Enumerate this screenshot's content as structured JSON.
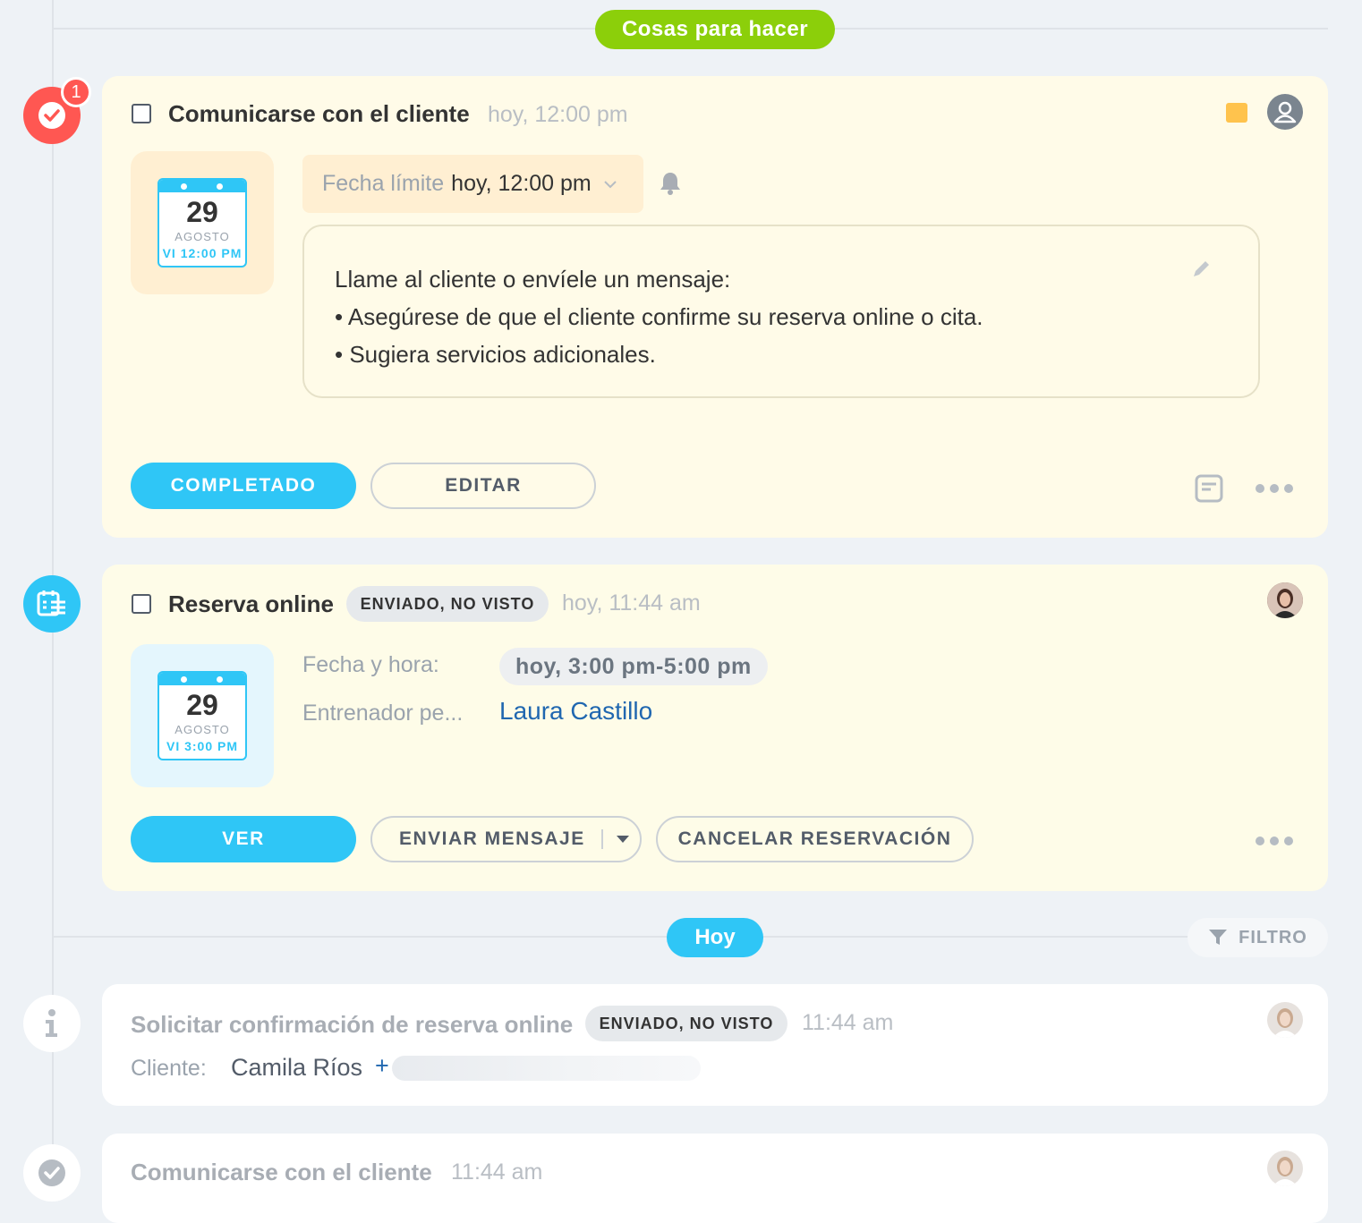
{
  "header_pill": "Cosas para hacer",
  "today_pill": "Hoy",
  "filter_label": "FILTRO",
  "task": {
    "badge_count": "1",
    "title": "Comunicarse con el cliente",
    "time": "hoy, 12:00 pm",
    "deadline_label": "Fecha límite",
    "deadline_value": "hoy, 12:00 pm",
    "calendar": {
      "day": "29",
      "month": "AGOSTO",
      "time": "VI 12:00 PM"
    },
    "description": {
      "line1": "Llame al cliente o envíele un mensaje:",
      "line2": "• Asegúrese de que el cliente confirme su reserva online o cita.",
      "line3": "• Sugiera servicios adicionales."
    },
    "complete_label": "COMPLETADO",
    "edit_label": "EDITAR",
    "color_tag": "#ffc34d"
  },
  "booking": {
    "title": "Reserva online",
    "status": "ENVIADO, NO VISTO",
    "time": "hoy, 11:44 am",
    "calendar": {
      "day": "29",
      "month": "AGOSTO",
      "time": "VI 3:00 PM"
    },
    "date_label": "Fecha y hora:",
    "date_value": "hoy, 3:00 pm-5:00 pm",
    "trainer_label": "Entrenador pe...",
    "trainer_value": "Laura Castillo",
    "view_label": "VER",
    "message_label": "ENVIAR MENSAJE",
    "cancel_label": "CANCELAR RESERVACIÓN"
  },
  "history": [
    {
      "title": "Solicitar confirmación de reserva online",
      "status": "ENVIADO, NO VISTO",
      "time": "11:44 am",
      "client_label": "Cliente:",
      "client_name": "Camila Ríos",
      "client_plus": "+"
    },
    {
      "title": "Comunicarse con el cliente",
      "time": "11:44 am"
    }
  ],
  "colors": {
    "accent_blue": "#2fc6f6",
    "accent_green": "#8ccf0a",
    "alert_red": "#ff5752",
    "link_blue": "#2067b0"
  }
}
